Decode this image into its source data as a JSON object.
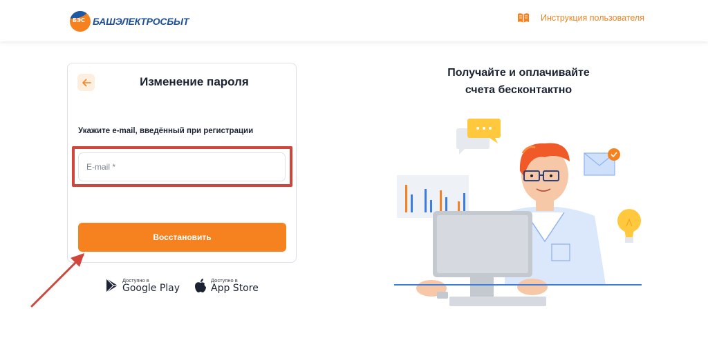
{
  "header": {
    "logo_mark": "БЭС",
    "logo_text": "БАШЭЛЕКТРОСБЫТ",
    "help_link": "Инструкция пользователя",
    "help_icon": "book-icon"
  },
  "card": {
    "title": "Изменение пароля",
    "back_icon": "arrow-left-icon",
    "label": "Укажите e-mail, введённый при регистрации",
    "email_value": "",
    "email_placeholder": "E-mail *",
    "submit_label": "Восстановить"
  },
  "stores": [
    {
      "small": "Доступно в",
      "big": "Google Play",
      "icon": "google-play-icon"
    },
    {
      "small": "Доступно в",
      "big": "App Store",
      "icon": "apple-icon"
    }
  ],
  "promo": {
    "title_line1": "Получайте и оплачивайте",
    "title_line2": "счета бесконтактно"
  },
  "colors": {
    "accent": "#f5821f",
    "brand_blue": "#1d4f93",
    "annotation_red": "#d0453c"
  }
}
